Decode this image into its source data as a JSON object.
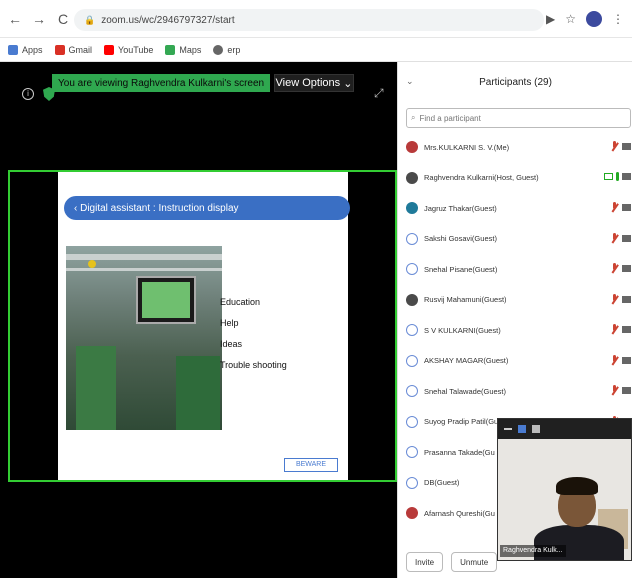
{
  "browser": {
    "url": "zoom.us/wc/2946797327/start",
    "bookmarks": [
      "Apps",
      "Gmail",
      "YouTube",
      "Maps",
      "erp"
    ]
  },
  "meeting": {
    "viewing_text": "You are viewing Raghvendra Kulkarni's screen",
    "view_options_label": "View Options"
  },
  "slide": {
    "header": "Digital assistant : Instruction display",
    "items": [
      "Education",
      "Help",
      "Ideas",
      "Trouble shooting"
    ],
    "logo_text": "BEWARE"
  },
  "participants": {
    "title": "Participants (29)",
    "search_placeholder": "Find a participant",
    "list": [
      {
        "name": "Mrs.KULKARNI S. V.(Me)",
        "avatar": "photo-red",
        "share": false
      },
      {
        "name": "Raghvendra Kulkarni(Host, Guest)",
        "avatar": "photo-dark",
        "share": true
      },
      {
        "name": "Jagruz Thakar(Guest)",
        "avatar": "photo-teal",
        "share": false
      },
      {
        "name": "Sakshi Gosavi(Guest)",
        "avatar": "default",
        "share": false
      },
      {
        "name": "Snehal Pisane(Guest)",
        "avatar": "default",
        "share": false
      },
      {
        "name": "Rusvij Mahamuni(Guest)",
        "avatar": "photo-dark",
        "share": false
      },
      {
        "name": "S V KULKARNI(Guest)",
        "avatar": "default",
        "share": false
      },
      {
        "name": "AKSHAY MAGAR(Guest)",
        "avatar": "default",
        "share": false
      },
      {
        "name": "Snehal Talawade(Guest)",
        "avatar": "default",
        "share": false
      },
      {
        "name": "Suyog Pradip Patil(Gu",
        "avatar": "default",
        "share": false
      },
      {
        "name": "Prasanna Takade(Gu",
        "avatar": "default",
        "share": false
      },
      {
        "name": "DB(Guest)",
        "avatar": "default",
        "share": false
      },
      {
        "name": "Afarnash Qureshi(Gu",
        "avatar": "photo-red",
        "share": false
      }
    ],
    "invite_label": "Invite",
    "unmute_label": "Unmute"
  },
  "selfview": {
    "name": "Raghvendra Kulk..."
  },
  "colors": {
    "share_border": "#33cc33",
    "viewing_bar": "#2fa84f",
    "slide_header": "#3a6fc4"
  }
}
